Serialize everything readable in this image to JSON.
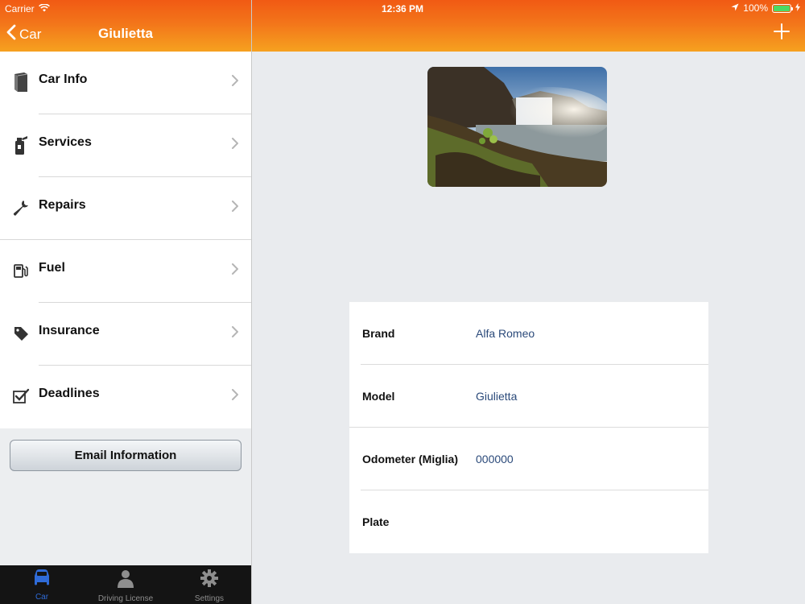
{
  "status_bar": {
    "carrier": "Carrier",
    "time": "12:36 PM",
    "battery": "100%"
  },
  "nav": {
    "back_label": "Car",
    "title": "Giulietta"
  },
  "menu": {
    "items": [
      {
        "label": "Car Info",
        "icon": "book-icon"
      },
      {
        "label": "Services",
        "icon": "oil-can-icon"
      },
      {
        "label": "Repairs",
        "icon": "wrench-icon"
      },
      {
        "label": "Fuel",
        "icon": "fuel-pump-icon"
      },
      {
        "label": "Insurance",
        "icon": "tag-icon"
      },
      {
        "label": "Deadlines",
        "icon": "checkbox-icon"
      }
    ]
  },
  "email_button": "Email Information",
  "tabs": [
    {
      "label": "Car",
      "icon": "car-icon",
      "active": true
    },
    {
      "label": "Driving License",
      "icon": "person-icon",
      "active": false
    },
    {
      "label": "Settings",
      "icon": "gear-icon",
      "active": false
    }
  ],
  "car_details": {
    "rows": [
      {
        "key": "Brand",
        "value": "Alfa Romeo"
      },
      {
        "key": "Model",
        "value": "Giulietta"
      },
      {
        "key": "Odometer (Miglia)",
        "value": "000000"
      },
      {
        "key": "Plate",
        "value": ""
      }
    ]
  },
  "colors": {
    "accent": "#f3751a",
    "link_value": "#2b4a7a",
    "tab_active": "#2f6bd8"
  }
}
